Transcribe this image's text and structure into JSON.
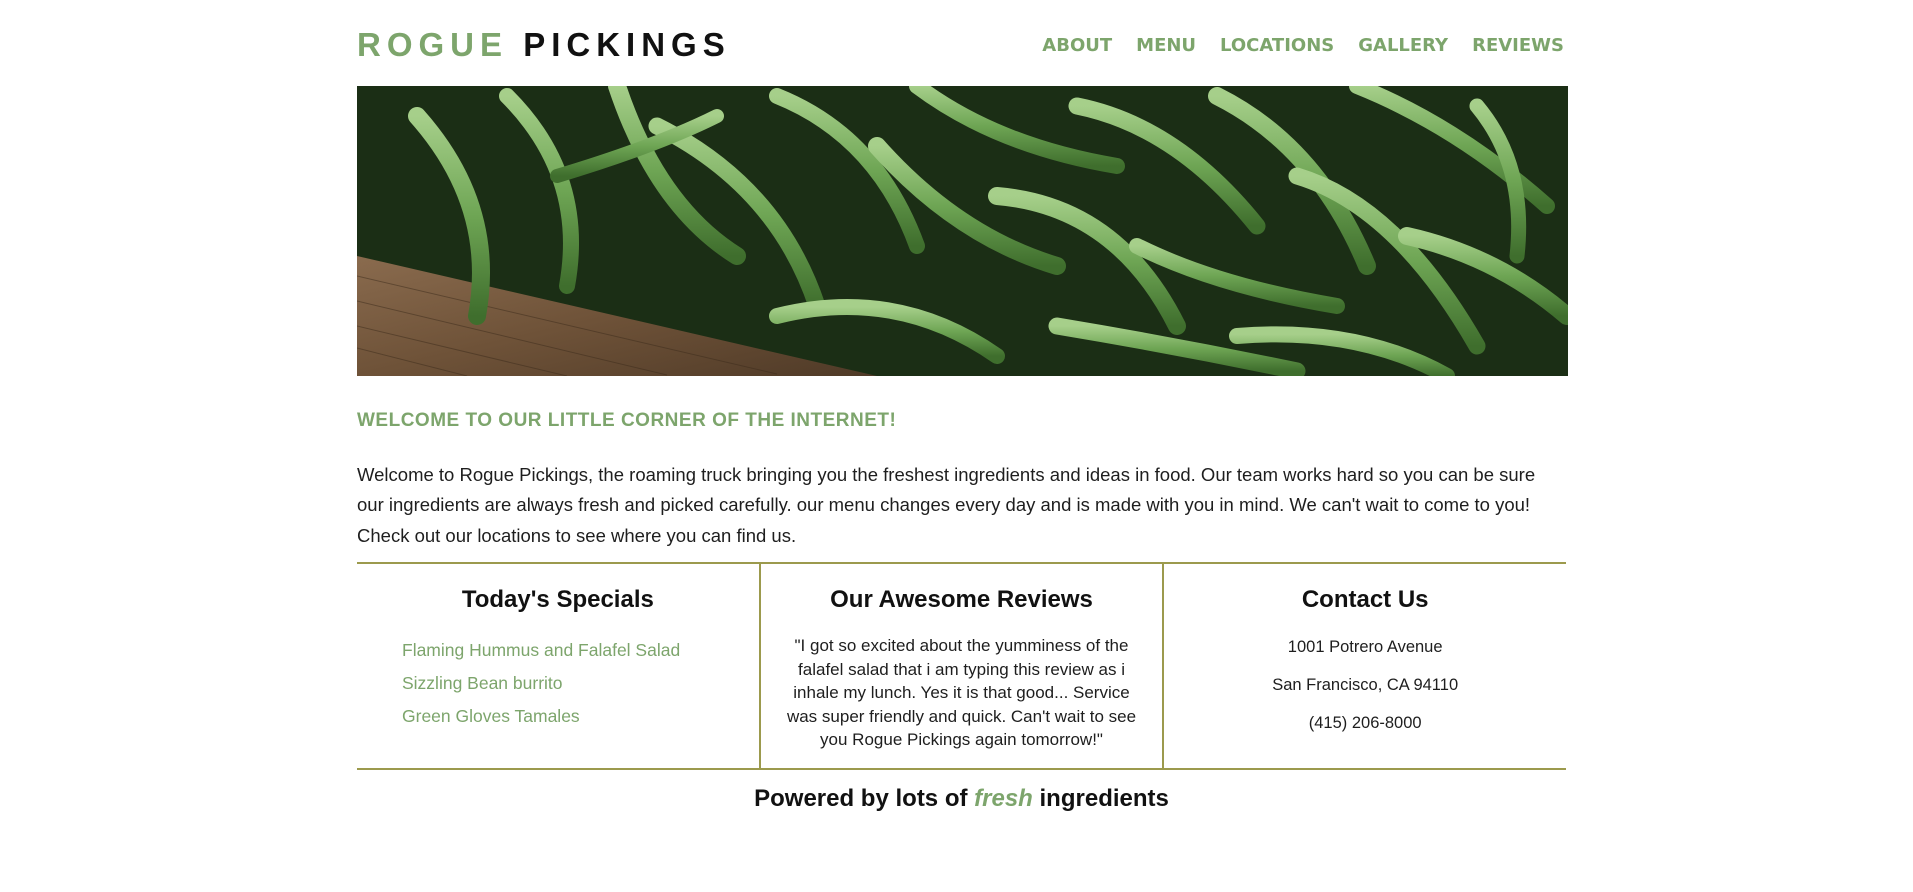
{
  "brand": {
    "logo_part1": "ROGUE",
    "logo_part2": "PICKINGS",
    "accent_color": "#7da56c",
    "border_color": "#9c9a4d"
  },
  "nav": {
    "items": [
      {
        "label": "ABOUT"
      },
      {
        "label": "MENU"
      },
      {
        "label": "LOCATIONS"
      },
      {
        "label": "GALLERY"
      },
      {
        "label": "REVIEWS"
      }
    ]
  },
  "hero": {
    "image_subject": "green-beans-in-wooden-crate"
  },
  "welcome": {
    "title": "WELCOME TO OUR LITTLE CORNER OF THE INTERNET!",
    "text": "Welcome to Rogue Pickings, the roaming truck bringing you the freshest ingredients and ideas in food. Our team works hard so you can be sure our ingredients are always fresh and picked carefully. our menu changes every day and is made with you in mind. We can't wait to come to you! Check out our locations to see where you can find us."
  },
  "specials": {
    "title": "Today's Specials",
    "items": [
      {
        "label": "Flaming Hummus and Falafel Salad"
      },
      {
        "label": "Sizzling Bean burrito"
      },
      {
        "label": "Green Gloves Tamales"
      }
    ]
  },
  "reviews": {
    "title": "Our Awesome Reviews",
    "quote": "\"I got so excited about the yumminess of the falafel salad that i am typing this review as i inhale my lunch. Yes it is that good... Service was super friendly and quick. Can't wait to see you Rogue Pickings again tomorrow!\""
  },
  "contact": {
    "title": "Contact Us",
    "street": "1001 Potrero Avenue",
    "city": "San Francisco, CA 94110",
    "phone": "(415) 206-8000"
  },
  "footer": {
    "prefix": "Powered by lots of",
    "emphasis": "fresh",
    "suffix": "ingredients"
  }
}
